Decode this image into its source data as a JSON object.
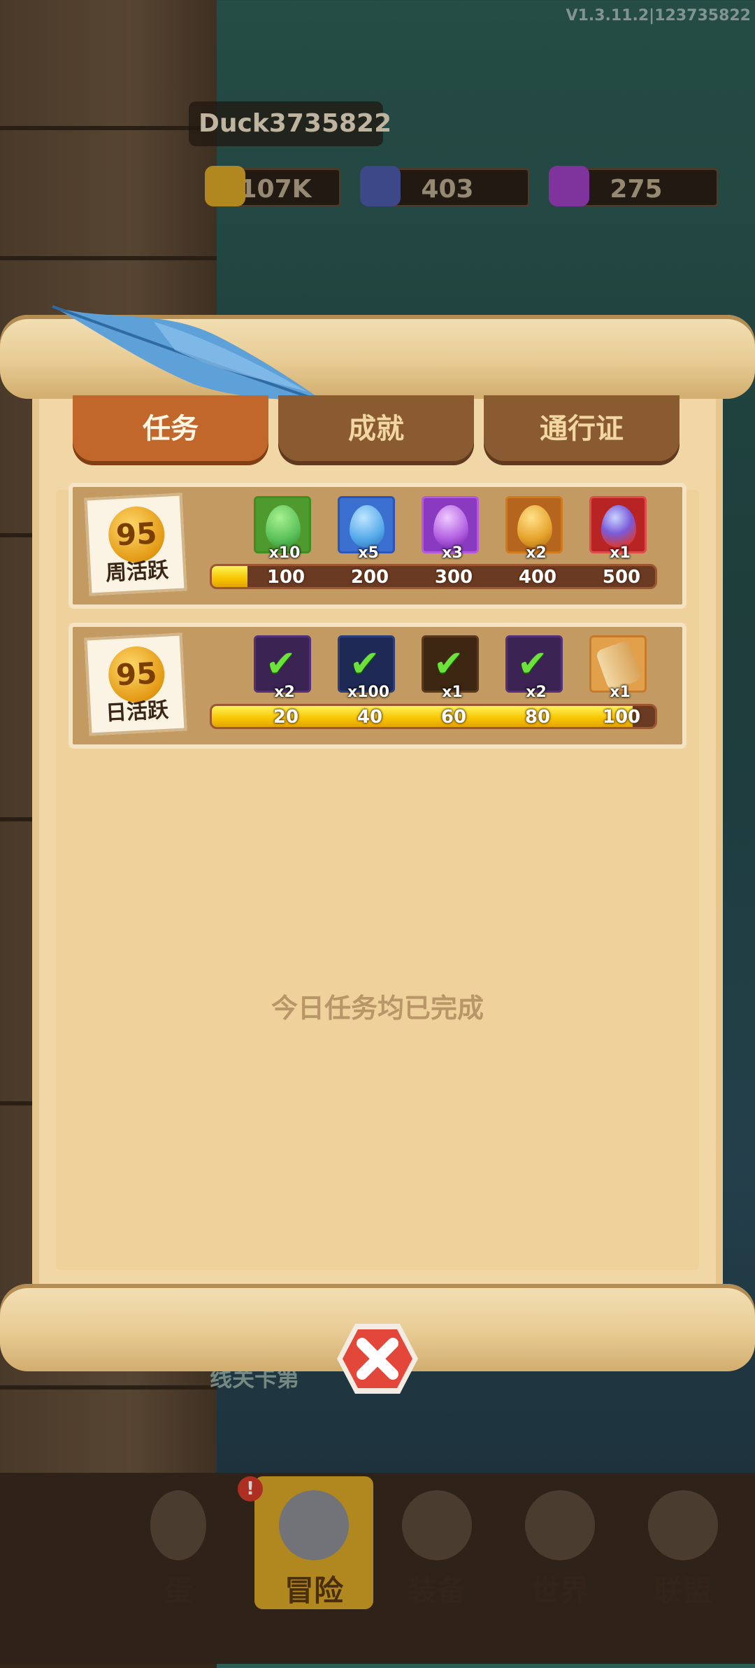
{
  "version": "V1.3.11.2|123735822",
  "player": {
    "name": "Duck3735822"
  },
  "resources": [
    {
      "value": "107K",
      "icon": "gold-icon",
      "color": "#d8a527"
    },
    {
      "value": "403",
      "icon": "gem-icon",
      "color": "#4b58a8"
    },
    {
      "value": "275",
      "icon": "crystal-icon",
      "color": "#9b3fc0"
    }
  ],
  "tabs": [
    {
      "label": "任务",
      "active": true
    },
    {
      "label": "成就",
      "active": false
    },
    {
      "label": "通行证",
      "active": false
    }
  ],
  "weekly": {
    "points": "95",
    "label": "周活跃",
    "progress_fraction": 0.08,
    "thresholds": [
      "100",
      "200",
      "300",
      "400",
      "500"
    ],
    "rewards": [
      {
        "icon": "green-egg-icon",
        "count": "x10",
        "color": "#5cc25a",
        "frame": "#3f8f1f"
      },
      {
        "icon": "blue-egg-icon",
        "count": "x5",
        "color": "#55a9ea",
        "frame": "#2b55b8"
      },
      {
        "icon": "purple-egg-icon",
        "count": "x3",
        "color": "#b15ee0",
        "frame": "#7a2ab0"
      },
      {
        "icon": "gold-egg-icon",
        "count": "x2",
        "color": "#e6a32c",
        "frame": "#b5651d"
      },
      {
        "icon": "red-egg-icon",
        "count": "x1",
        "color": "#d33b3b",
        "frame": "#a51c1c"
      }
    ]
  },
  "daily": {
    "points": "95",
    "label": "日活跃",
    "progress_fraction": 0.95,
    "thresholds": [
      "20",
      "40",
      "60",
      "80",
      "100"
    ],
    "rewards": [
      {
        "icon": "claimed-check-icon",
        "count": "x2",
        "frame": "#55307a",
        "bg": "#3b2454"
      },
      {
        "icon": "claimed-check-icon",
        "count": "x100",
        "frame": "#2b3d7a",
        "bg": "#1e2a55"
      },
      {
        "icon": "claimed-check-icon",
        "count": "x1",
        "frame": "#5a3a1e",
        "bg": "#3d2612"
      },
      {
        "icon": "claimed-check-icon",
        "count": "x2",
        "frame": "#55307a",
        "bg": "#3b2454"
      },
      {
        "icon": "scroll-icon",
        "count": "x1",
        "frame": "#c77a2a",
        "bg": "#e3a04a"
      }
    ]
  },
  "empty_message": "今日任务均已完成",
  "stage_text": "线关卡第",
  "nav": [
    {
      "label": "蛋",
      "icon": "egg-nav-icon",
      "active": false
    },
    {
      "label": "冒险",
      "icon": "crossed-swords-icon",
      "active": true
    },
    {
      "label": "装备",
      "icon": "anvil-icon",
      "active": false
    },
    {
      "label": "世界",
      "icon": "lock-icon",
      "active": false
    },
    {
      "label": "联盟",
      "icon": "lock-icon",
      "active": false
    }
  ],
  "nav_badge": "!"
}
